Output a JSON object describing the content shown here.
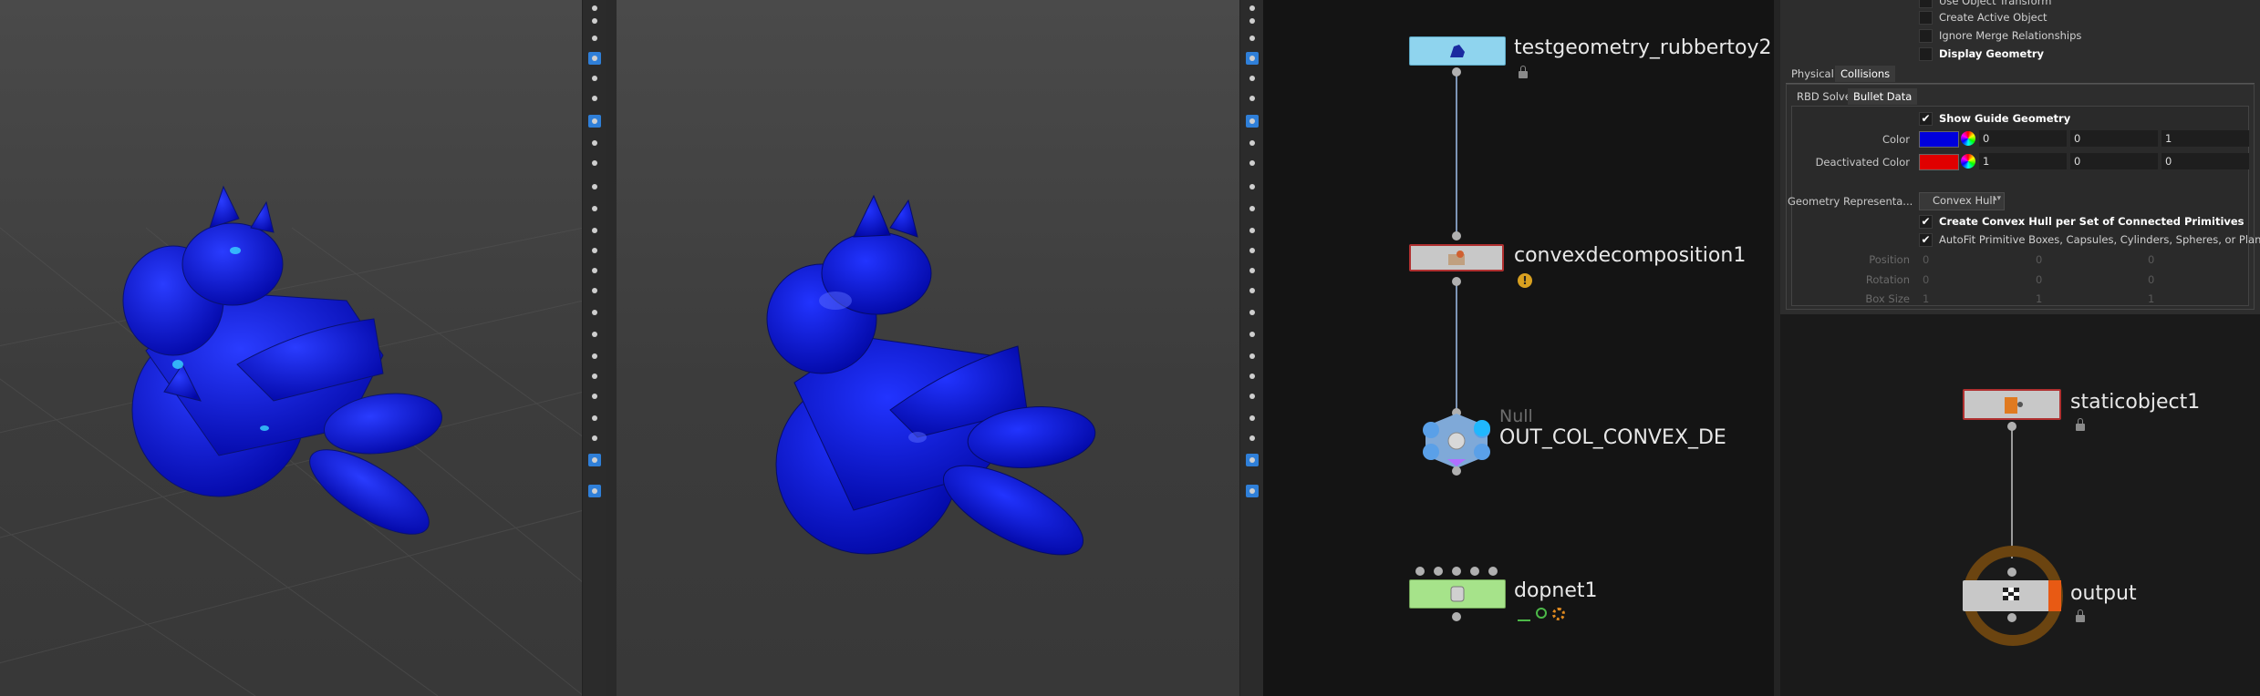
{
  "network": {
    "nodes": [
      {
        "id": "testgeometry",
        "label": "testgeometry_rubbertoy2"
      },
      {
        "id": "convexdecomp",
        "label": "convexdecomposition1"
      },
      {
        "id": "null",
        "type_label": "Null",
        "label": "OUT_COL_CONVEX_DE"
      },
      {
        "id": "dopnet",
        "label": "dopnet1"
      },
      {
        "id": "staticobject",
        "label": "staticobject1"
      },
      {
        "id": "output",
        "label": "output"
      }
    ]
  },
  "params": {
    "top_items": [
      {
        "label": "Use Object Transform",
        "checked": false
      },
      {
        "label": "Create Active Object",
        "checked": false
      },
      {
        "label": "Ignore Merge Relationships",
        "checked": false
      },
      {
        "label": "Display Geometry",
        "checked": false
      }
    ],
    "tabs": [
      "Physical",
      "Collisions"
    ],
    "subtabs": [
      "RBD Solver",
      "Bullet Data"
    ],
    "show_guide_label": "Show Guide Geometry",
    "color": {
      "label": "Color",
      "swatch": "#0000dd",
      "values": [
        "0",
        "0",
        "1"
      ]
    },
    "deactivated_color": {
      "label": "Deactivated Color",
      "swatch": "#e00000",
      "values": [
        "1",
        "0",
        "0"
      ]
    },
    "geo_rep": {
      "label": "Geometry Representa...",
      "value": "Convex Hull"
    },
    "create_convex_label": "Create Convex Hull per Set of Connected Primitives",
    "autofit_label": "AutoFit Primitive Boxes, Capsules, Cylinders, Spheres, or Planes to...",
    "position": {
      "label": "Position",
      "values": [
        "0",
        "0",
        "0"
      ]
    },
    "rotation": {
      "label": "Rotation",
      "values": [
        "0",
        "0",
        "0"
      ]
    },
    "box_size": {
      "label": "Box Size",
      "values": [
        "1",
        "1",
        "1"
      ]
    }
  },
  "colors": {
    "accent": "#2f7fd8",
    "toy_blue": "#0a14c8",
    "node_cyan": "#8fd4ee",
    "node_green": "#a6e38a"
  }
}
